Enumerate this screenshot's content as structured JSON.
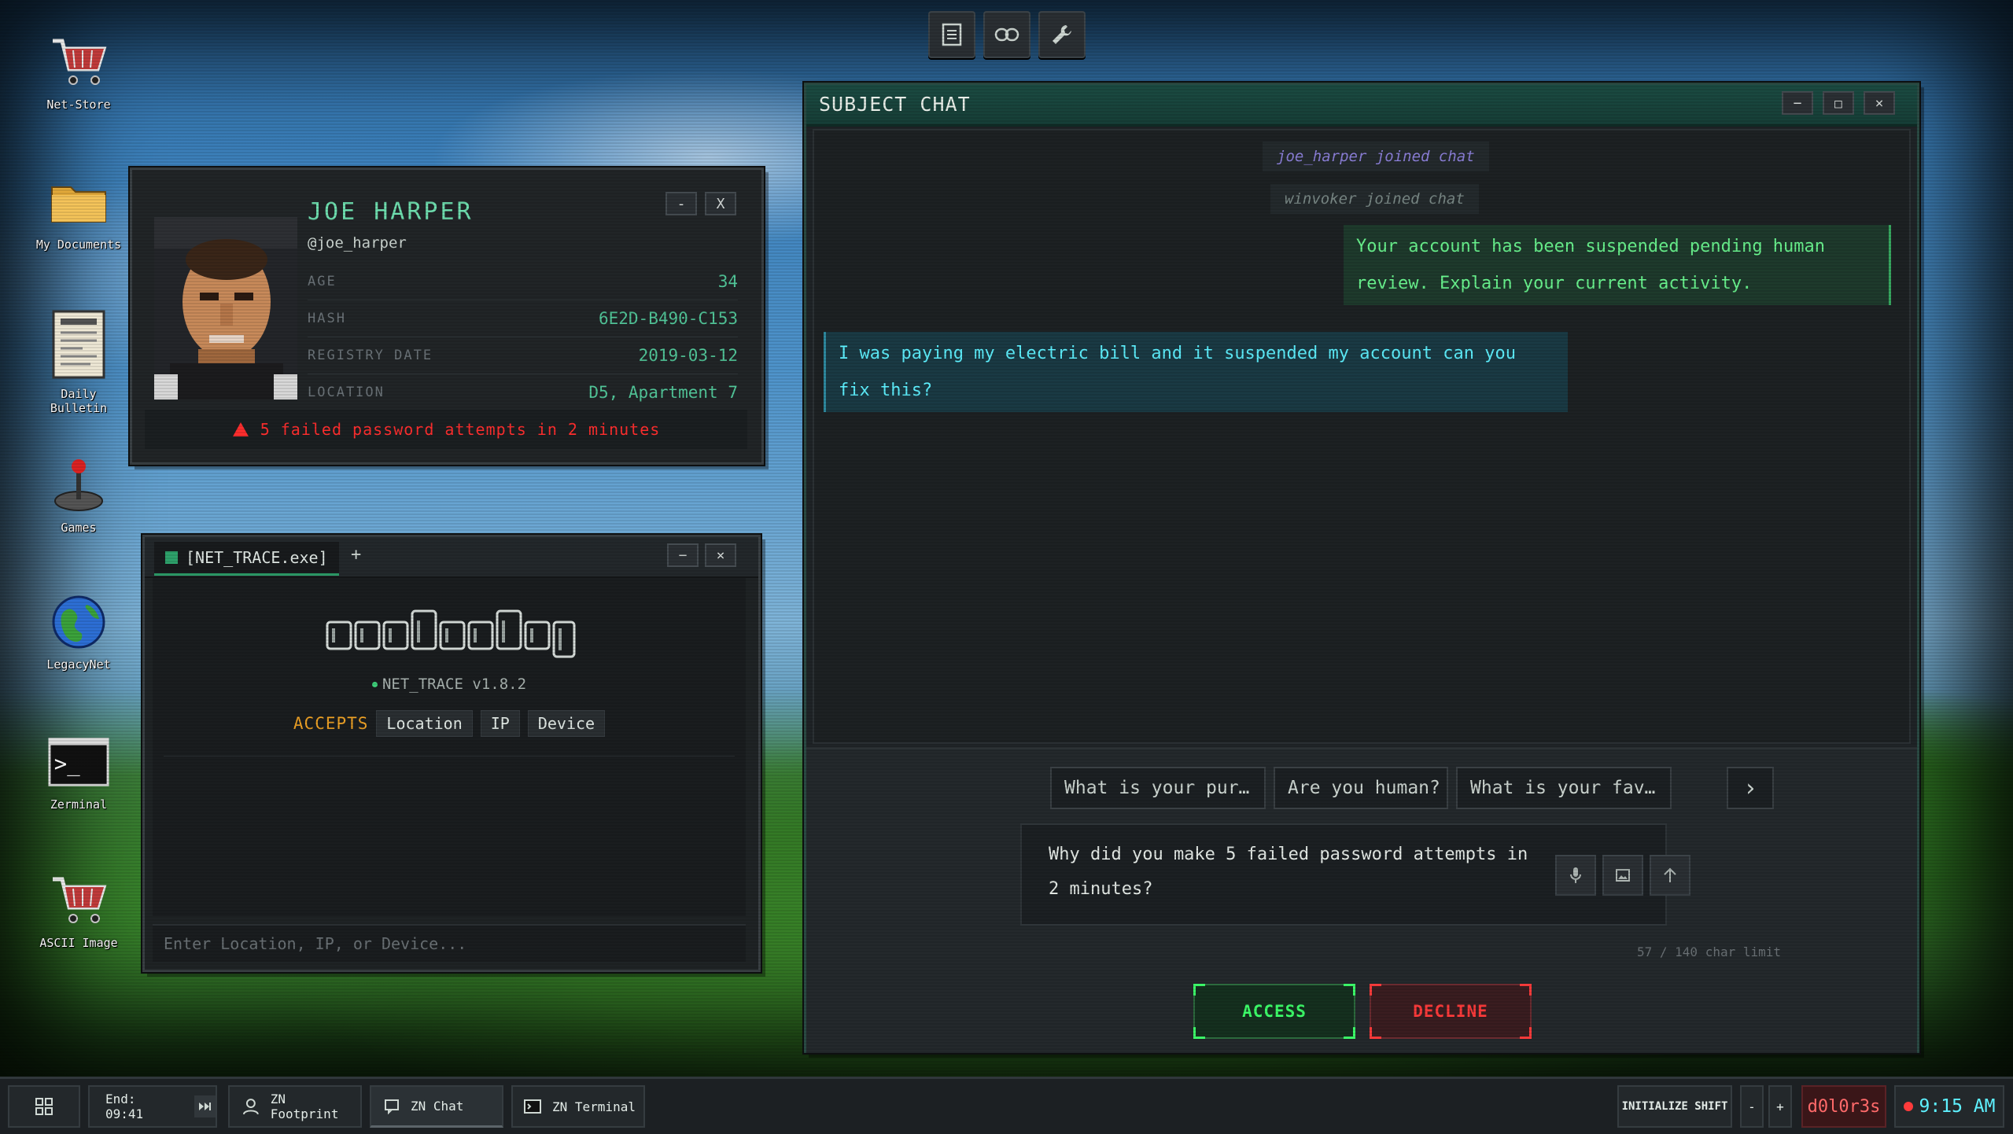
{
  "desktop": {
    "icons": [
      {
        "label": "Net-Store",
        "icon": "shopping-cart-icon"
      },
      {
        "label": "My Documents",
        "icon": "folder-icon"
      },
      {
        "label": "Daily Bulletin",
        "icon": "newspaper-icon"
      },
      {
        "label": "Games",
        "icon": "joystick-icon"
      },
      {
        "label": "LegacyNet",
        "icon": "globe-icon"
      },
      {
        "label": "Zerminal",
        "icon": "terminal-icon"
      },
      {
        "label": "ASCII Image",
        "icon": "shopping-cart-icon"
      }
    ]
  },
  "toolbar": {
    "icons": [
      "document-icon",
      "link-icon",
      "wrench-icon"
    ]
  },
  "profile": {
    "name": "JOE HARPER",
    "handle": "@joe_harper",
    "minimize_label": "-",
    "close_label": "X",
    "fields": [
      {
        "key": "AGE",
        "value": "34"
      },
      {
        "key": "HASH",
        "value": "6E2D-B490-C153"
      },
      {
        "key": "REGISTRY DATE",
        "value": "2019-03-12"
      },
      {
        "key": "LOCATION",
        "value": "D5, Apartment 7"
      }
    ],
    "alert": "5 failed password attempts in 2 minutes"
  },
  "trace": {
    "tab_label": "[NET_TRACE.exe]",
    "new_tab_label": "+",
    "minimize_label": "−",
    "close_label": "×",
    "version": "NET_TRACE v1.8.2",
    "accepts_label": "ACCEPTS",
    "accepts": [
      "Location",
      "IP",
      "Device"
    ],
    "input_placeholder": "Enter Location, IP, or Device..."
  },
  "chat": {
    "title": "SUBJECT CHAT",
    "minimize_label": "−",
    "maximize_label": "□",
    "close_label": "×",
    "system": [
      "joe_harper joined chat",
      "winvoker joined chat"
    ],
    "outgoing": "Your account has been suspended pending human review. Explain your current activity.",
    "incoming": "I was paying my electric bill and it suspended my account can you fix this?",
    "suggestions": [
      "What is your pur…",
      "Are you human?",
      "What is your fav…"
    ],
    "next_label": "›",
    "draft": "Why did you make 5 failed password attempts in 2 minutes?",
    "char_count": "57 / 140 char limit",
    "access_label": "ACCESS",
    "decline_label": "DECLINE",
    "colors": {
      "access": "#3dff6a",
      "decline": "#ff3b3b",
      "outgoing": "#6af58f",
      "incoming": "#5ef1ff"
    }
  },
  "taskbar": {
    "end_label": "End: 09:41",
    "apps": [
      "ZN Footprint",
      "ZN Chat",
      "ZN Terminal"
    ],
    "initialize_label": "INITIALIZE SHIFT",
    "minus_label": "-",
    "plus_label": "+",
    "user": "d0l0r3s",
    "clock": "9:15 AM"
  }
}
